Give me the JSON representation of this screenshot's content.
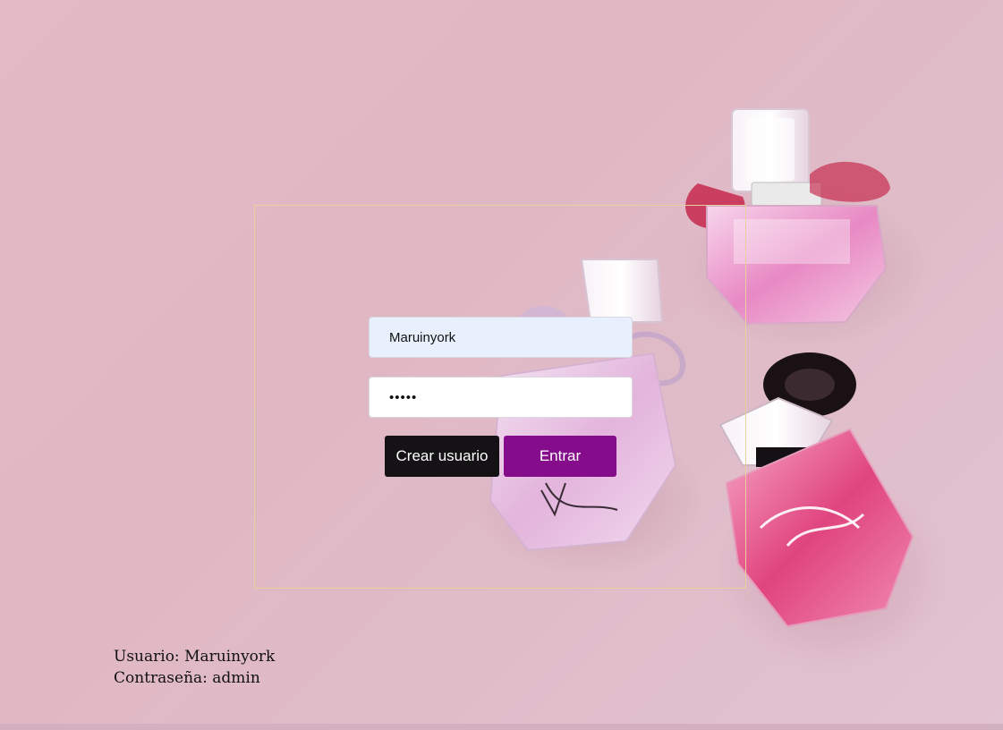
{
  "login": {
    "username_value": "Maruinyork",
    "password_value": "admin",
    "create_label": "Crear usuario",
    "enter_label": "Entrar"
  },
  "hints": {
    "user_line": "Usuario: Maruinyork",
    "pass_line": "Contraseña: admin"
  },
  "colors": {
    "background": "#e0b7c3",
    "create_button": "#141214",
    "enter_button": "#850d8c",
    "frame_border": "#e8cf9c",
    "username_fill": "#e8f0fe"
  },
  "background_image": {
    "subject": "perfume-bottles"
  }
}
